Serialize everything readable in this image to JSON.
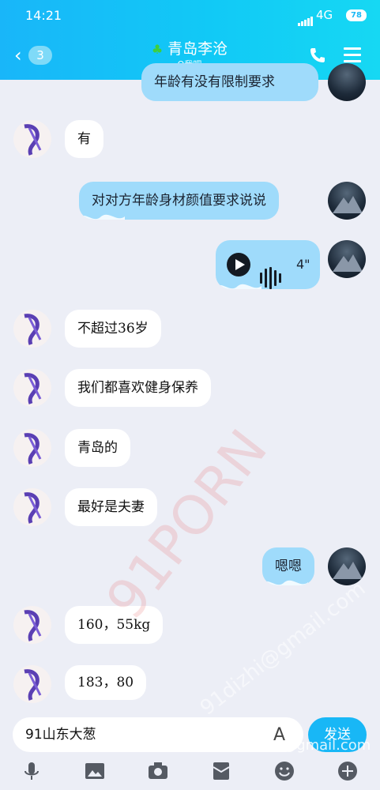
{
  "status": {
    "time": "14:21",
    "network": "4G",
    "battery": "78"
  },
  "header": {
    "back_count": "3",
    "title": "青岛李沧",
    "subtitle": "Q我吧"
  },
  "messages": {
    "m0": "年龄有没有限制要求",
    "m1": "有",
    "m2": "对对方年龄身材颜值要求说说",
    "m3_duration": "4\"",
    "m4": "不超过36岁",
    "m5": "我们都喜欢健身保养",
    "m6": "青岛的",
    "m7": "最好是夫妻",
    "m8": "嗯嗯",
    "m9": "160，55kg",
    "m10": "183，80"
  },
  "input": {
    "value": "91山东大葱",
    "send_label": "发送"
  },
  "watermark": {
    "w1": "91PORN",
    "w2": "91dizhi@gmail.com",
    "w3": "91dizhi@gmail.com"
  },
  "icons": {
    "leaf": "leaf-icon",
    "phone": "phone-icon",
    "menu": "menu-icon",
    "mic": "microphone-icon",
    "image": "image-icon",
    "camera": "camera-icon",
    "redpacket": "red-packet-icon",
    "emoji": "emoji-icon",
    "plus": "plus-icon"
  },
  "colors": {
    "header_start": "#19b6f9",
    "header_end": "#16d8f3",
    "bubble_self": "#9fdbfb",
    "send": "#18b7f6"
  }
}
